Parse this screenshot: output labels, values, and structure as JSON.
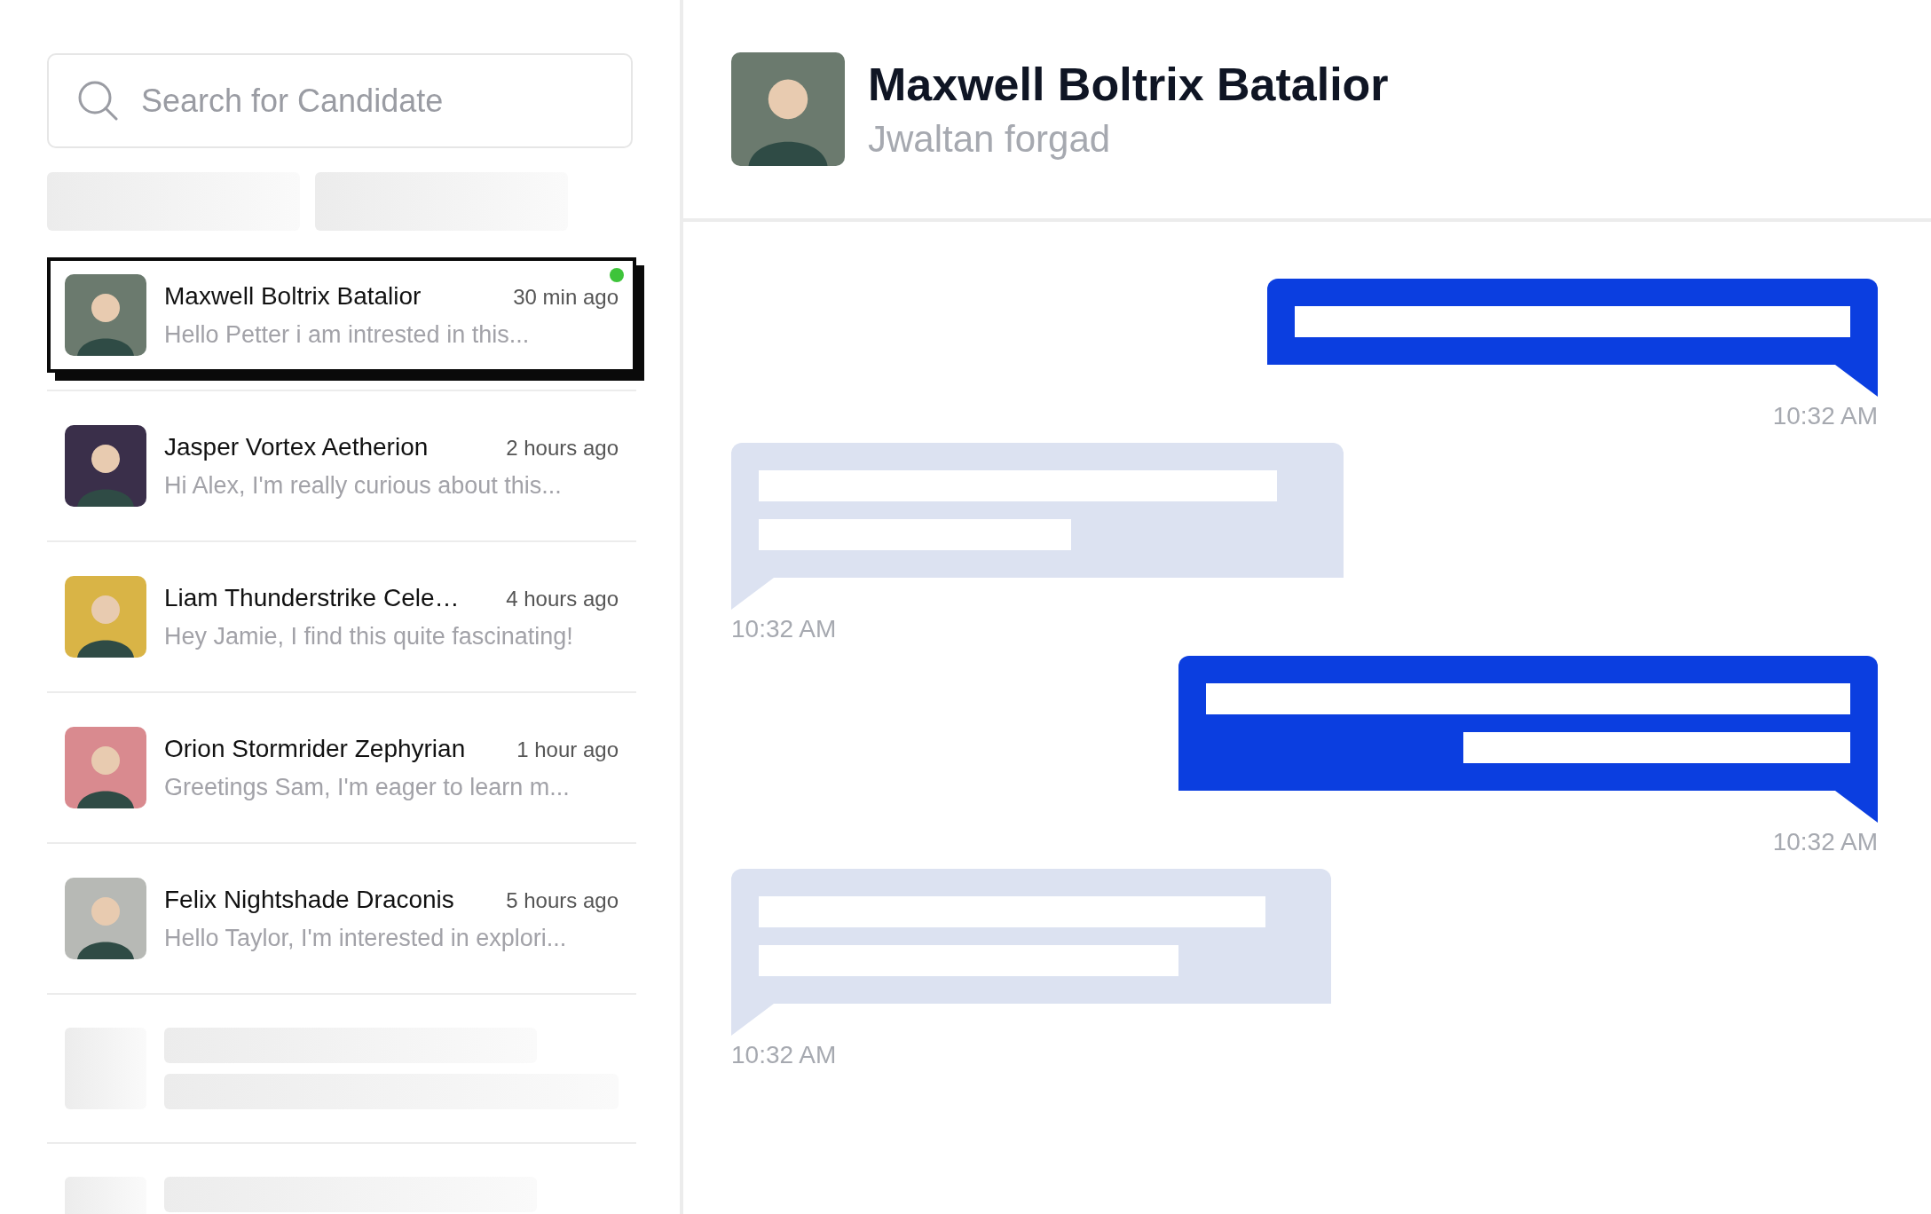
{
  "search": {
    "placeholder": "Search for Candidate"
  },
  "contacts": [
    {
      "name": "Maxwell Boltrix Batalior",
      "time": "30 min ago",
      "preview": "Hello Petter i am intrested in this...",
      "selected": true,
      "online": true
    },
    {
      "name": "Jasper Vortex Aetherion",
      "time": "2 hours ago",
      "preview": "Hi Alex, I'm really curious about this...",
      "selected": false,
      "online": false
    },
    {
      "name": "Liam Thunderstrike Cele…",
      "time": "4 hours ago",
      "preview": "Hey Jamie, I find this quite fascinating!",
      "selected": false,
      "online": false
    },
    {
      "name": "Orion Stormrider Zephyrian",
      "time": "1 hour ago",
      "preview": "Greetings Sam, I'm eager to learn m...",
      "selected": false,
      "online": false
    },
    {
      "name": "Felix Nightshade Draconis",
      "time": "5 hours ago",
      "preview": "Hello Taylor, I'm interested in explori...",
      "selected": false,
      "online": false
    }
  ],
  "chat": {
    "name": "Maxwell Boltrix Batalior",
    "subtitle": "Jwaltan forgad"
  },
  "messages": [
    {
      "kind": "outgoing",
      "time": "10:32 AM"
    },
    {
      "kind": "incoming",
      "time": "10:32 AM"
    },
    {
      "kind": "outgoing",
      "time": "10:32 AM"
    },
    {
      "kind": "incoming",
      "time": "10:32 AM"
    }
  ]
}
